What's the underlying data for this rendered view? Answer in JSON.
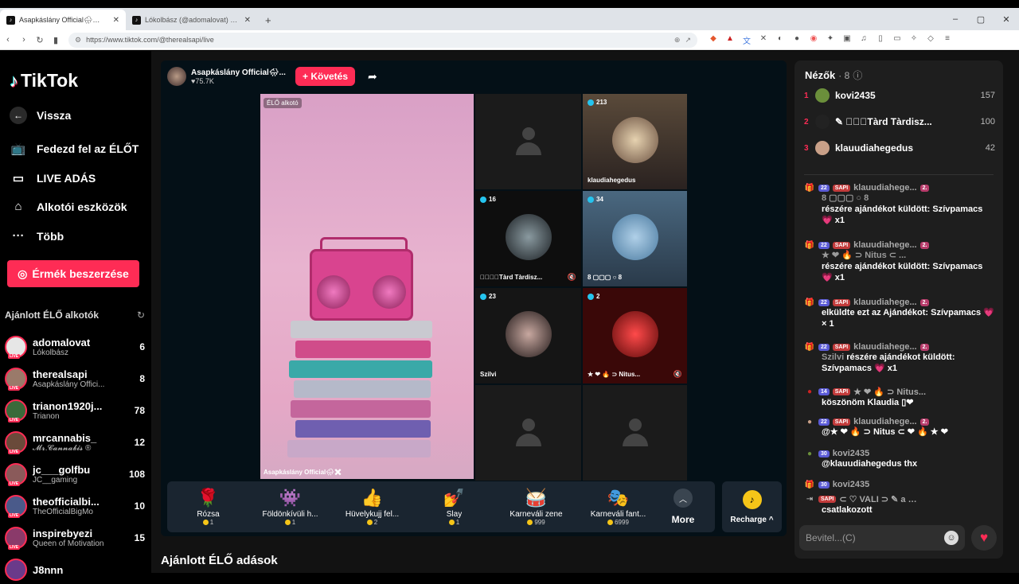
{
  "browser": {
    "tabs": [
      {
        "title": "Asapkáslány Official🌧✖ (@",
        "active": true
      },
      {
        "title": "Lókolbász (@adomalovat) ÉLŐ adások",
        "active": false
      }
    ],
    "new_tab": "+",
    "url": "https://www.tiktok.com/@therealsapi/live",
    "window_controls": [
      "–",
      "▢",
      "✕"
    ]
  },
  "sidebar": {
    "logo": "TikTok",
    "nav": [
      {
        "label": "Vissza",
        "icon": "back-arrow-icon"
      },
      {
        "label": "Fedezd fel az ÉLŐT",
        "icon": "tv-icon"
      },
      {
        "label": "LIVE ADÁS",
        "icon": "video-camera-icon"
      },
      {
        "label": "Alkotói eszközök",
        "icon": "house-icon"
      },
      {
        "label": "Több",
        "icon": "more-dots-icon"
      }
    ],
    "coin_button": "Érmék beszerzése",
    "recommended_header": "Ajánlott ÉLŐ alkotók",
    "creators": [
      {
        "name": "adomalovat",
        "sub": "Lókolbász",
        "count": "6"
      },
      {
        "name": "therealsapi",
        "sub": "Asapkáslány Offici...",
        "count": "8"
      },
      {
        "name": "trianon1920j...",
        "sub": "Trianon",
        "count": "78"
      },
      {
        "name": "mrcannabis_",
        "sub": "𝓜𝓻.𝓒𝓪𝓷𝓷𝓪𝓫𝓲𝓼 ®",
        "count": "12"
      },
      {
        "name": "jc___golfbu",
        "sub": "JC__gaming",
        "count": "108"
      },
      {
        "name": "theofficialbi...",
        "sub": "TheOfficialBigMo",
        "count": "10"
      },
      {
        "name": "inspirebyezi",
        "sub": "Queen of Motivation",
        "count": "15"
      },
      {
        "name": "J8nnn",
        "sub": "",
        "count": ""
      }
    ]
  },
  "stream": {
    "host_name": "Asapkáslány Official🌧...",
    "host_likes": "♥75.7K",
    "follow_button": "+ Követés",
    "video_badge": "ÉLŐ alkotó",
    "video_caption": "Asapkáslány Official🌧✖",
    "grid": [
      {
        "viewers": "",
        "name": "",
        "empty": true
      },
      {
        "viewers": "213",
        "name": "klaudiahegedus",
        "empty": false
      },
      {
        "viewers": "16",
        "name": "✎⃝⃝⃝Tàrd Tàrdisz...",
        "empty": false
      },
      {
        "viewers": "34",
        "name": "8 ▢▢▢ ○ 8",
        "empty": false
      },
      {
        "viewers": "23",
        "name": "Szilvi",
        "empty": false
      },
      {
        "viewers": "2",
        "name": "★ ❤ 🔥 ⊃ Nitus...",
        "empty": false
      },
      {
        "viewers": "",
        "name": "",
        "empty": true
      },
      {
        "viewers": "",
        "name": "",
        "empty": true
      }
    ],
    "gifts": [
      {
        "name": "Rózsa",
        "price": "1",
        "icon": "rose-icon"
      },
      {
        "name": "Földönkívüli h...",
        "price": "1",
        "icon": "alien-icon"
      },
      {
        "name": "Hüvelykujj fel...",
        "price": "2",
        "icon": "thumbs-up-icon"
      },
      {
        "name": "Slay",
        "price": "1",
        "icon": "slay-icon"
      },
      {
        "name": "Karneváli zene",
        "price": "999",
        "icon": "drum-icon"
      },
      {
        "name": "Karneváli fant...",
        "price": "6999",
        "icon": "carnival-icon"
      }
    ],
    "more_label": "More",
    "recharge_label": "Recharge ^",
    "below_title": "Ajánlott ÉLŐ adások"
  },
  "chat": {
    "viewers_label": "Nézők",
    "viewers_count": "· 8",
    "ranking": [
      {
        "rank": "1",
        "name": "kovi2435",
        "value": "157"
      },
      {
        "rank": "2",
        "name": "✎ ⃝⃝⃝Tàrd Tàrdisz...",
        "value": "100"
      },
      {
        "rank": "3",
        "name": "klauudiahegedus",
        "value": "42"
      }
    ],
    "messages": [
      {
        "lvl": "22",
        "tag": "SAPI",
        "user": "klauudiahege...",
        "rank": "2.",
        "text": "részére ajándékot küldött: Szívpamacs 💗 x1",
        "pre": "8 ▢▢▢ ○ 8"
      },
      {
        "lvl": "22",
        "tag": "SAPI",
        "user": "klauudiahege...",
        "rank": "2.",
        "text": "részére ajándékot küldött: Szívpamacs 💗 x1",
        "pre": "★ ❤ 🔥 ⊃ Nitus ⊂ ..."
      },
      {
        "lvl": "22",
        "tag": "SAPI",
        "user": "klauudiahege...",
        "rank": "2.",
        "text": "elküldte ezt az Ajándékot: Szívpamacs 💗 × 1",
        "pre": ""
      },
      {
        "lvl": "22",
        "tag": "SAPI",
        "user": "klauudiahege...",
        "rank": "2.",
        "text": "részére ajándékot küldött: Szívpamacs 💗 x1",
        "pre": "Szilvi"
      },
      {
        "lvl": "14",
        "tag": "SAPI",
        "user": "★ ❤ 🔥 ⊃ Nitus...",
        "rank": "",
        "text": "köszönöm Klaudia ▯❤",
        "pre": ""
      },
      {
        "lvl": "22",
        "tag": "SAPI",
        "user": "klauudiahege...",
        "rank": "2.",
        "text": "@★ ❤ 🔥 ⊃ Nitus ⊂ ❤ 🔥 ★ ❤",
        "pre": ""
      },
      {
        "lvl": "30",
        "tag": "",
        "user": "kovi2435",
        "rank": "",
        "text": "@klauudiahegedus thx",
        "pre": ""
      },
      {
        "lvl": "30",
        "tag": "",
        "user": "kovi2435",
        "rank": "",
        "text": "",
        "pre": ""
      },
      {
        "lvl": "",
        "tag": "SAPI",
        "user": "⊂ ♡ VALI ⊃ ✎ a d...",
        "rank": "",
        "text": "csatlakozott",
        "pre": ""
      }
    ],
    "input_placeholder": "Bevitel...(C)"
  }
}
